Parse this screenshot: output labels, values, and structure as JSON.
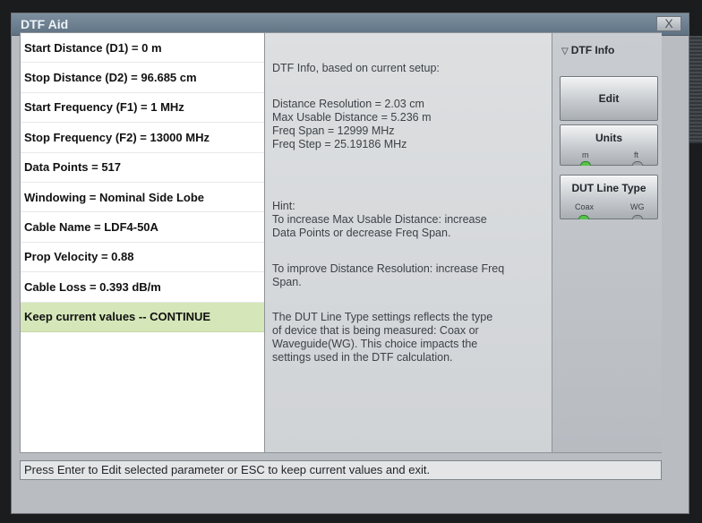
{
  "window": {
    "title": "DTF Aid",
    "close_label": "X"
  },
  "parameters": [
    {
      "label": "Start Distance (D1) = 0 m"
    },
    {
      "label": "Stop Distance (D2) = 96.685 cm"
    },
    {
      "label": "Start Frequency (F1) = 1 MHz"
    },
    {
      "label": "Stop Frequency (F2) = 13000 MHz"
    },
    {
      "label": "Data Points = 517"
    },
    {
      "label": "Windowing = Nominal Side Lobe"
    },
    {
      "label": "Cable Name = LDF4-50A"
    },
    {
      "label": "Prop Velocity = 0.88"
    },
    {
      "label": "Cable Loss = 0.393 dB/m"
    },
    {
      "label": "Keep current values -- CONTINUE",
      "selected": true
    }
  ],
  "info": {
    "heading": "DTF Info, based on current setup:",
    "details": "Distance Resolution = 2.03 cm\nMax Usable Distance = 5.236 m\nFreq Span = 12999 MHz\nFreq Step = 25.19186 MHz",
    "hint": "Hint:\nTo increase Max Usable Distance: increase\nData Points or decrease Freq Span.",
    "resolution_tip": "To improve Distance Resolution: increase Freq\nSpan.",
    "line_type_note": "The DUT Line Type settings reflects the type\nof device that is being measured: Coax or\nWaveguide(WG). This choice impacts the\nsettings used in the DTF calculation."
  },
  "side": {
    "menu_label": "DTF Info",
    "edit_label": "Edit",
    "units": {
      "title": "Units",
      "option_a": "m",
      "option_b": "ft",
      "selected": "m"
    },
    "dut_line_type": {
      "title": "DUT Line Type",
      "option_a": "Coax",
      "option_b": "WG",
      "selected": "Coax"
    }
  },
  "status_text": "Press Enter to Edit selected parameter or ESC to keep current values and exit."
}
